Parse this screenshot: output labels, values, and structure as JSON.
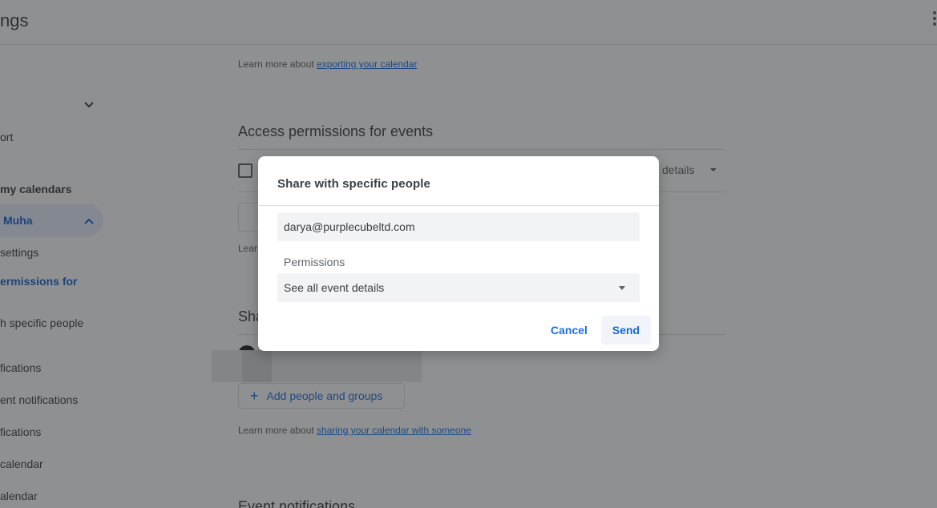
{
  "header": {
    "title": "ngs"
  },
  "sidebar": {
    "items": [
      {
        "label": "ort"
      },
      {
        "label": "my calendars"
      },
      {
        "label": "Muha"
      },
      {
        "label": "settings"
      },
      {
        "label": "ermissions for"
      },
      {
        "label": "h specific people"
      },
      {
        "label": "fications"
      },
      {
        "label": "ent notifications"
      },
      {
        "label": "fications"
      },
      {
        "label": "calendar"
      },
      {
        "label": "alendar"
      }
    ]
  },
  "main": {
    "export_learn_prefix": "Learn more about ",
    "export_learn_link": "exporting your calendar",
    "access_title": "Access permissions for events",
    "access_select_text": "details",
    "learn_stub": "Learn",
    "share_stub": "Sha",
    "add_people_label": "Add people and groups",
    "share_learn_prefix": "Learn more about ",
    "share_learn_link": "sharing your calendar with someone",
    "event_notifications_title": "Event notifications"
  },
  "dialog": {
    "title": "Share with specific people",
    "email_value": "darya@purplecubeltd.com",
    "permissions_label": "Permissions",
    "permissions_value": "See all event details",
    "cancel_label": "Cancel",
    "send_label": "Send"
  }
}
